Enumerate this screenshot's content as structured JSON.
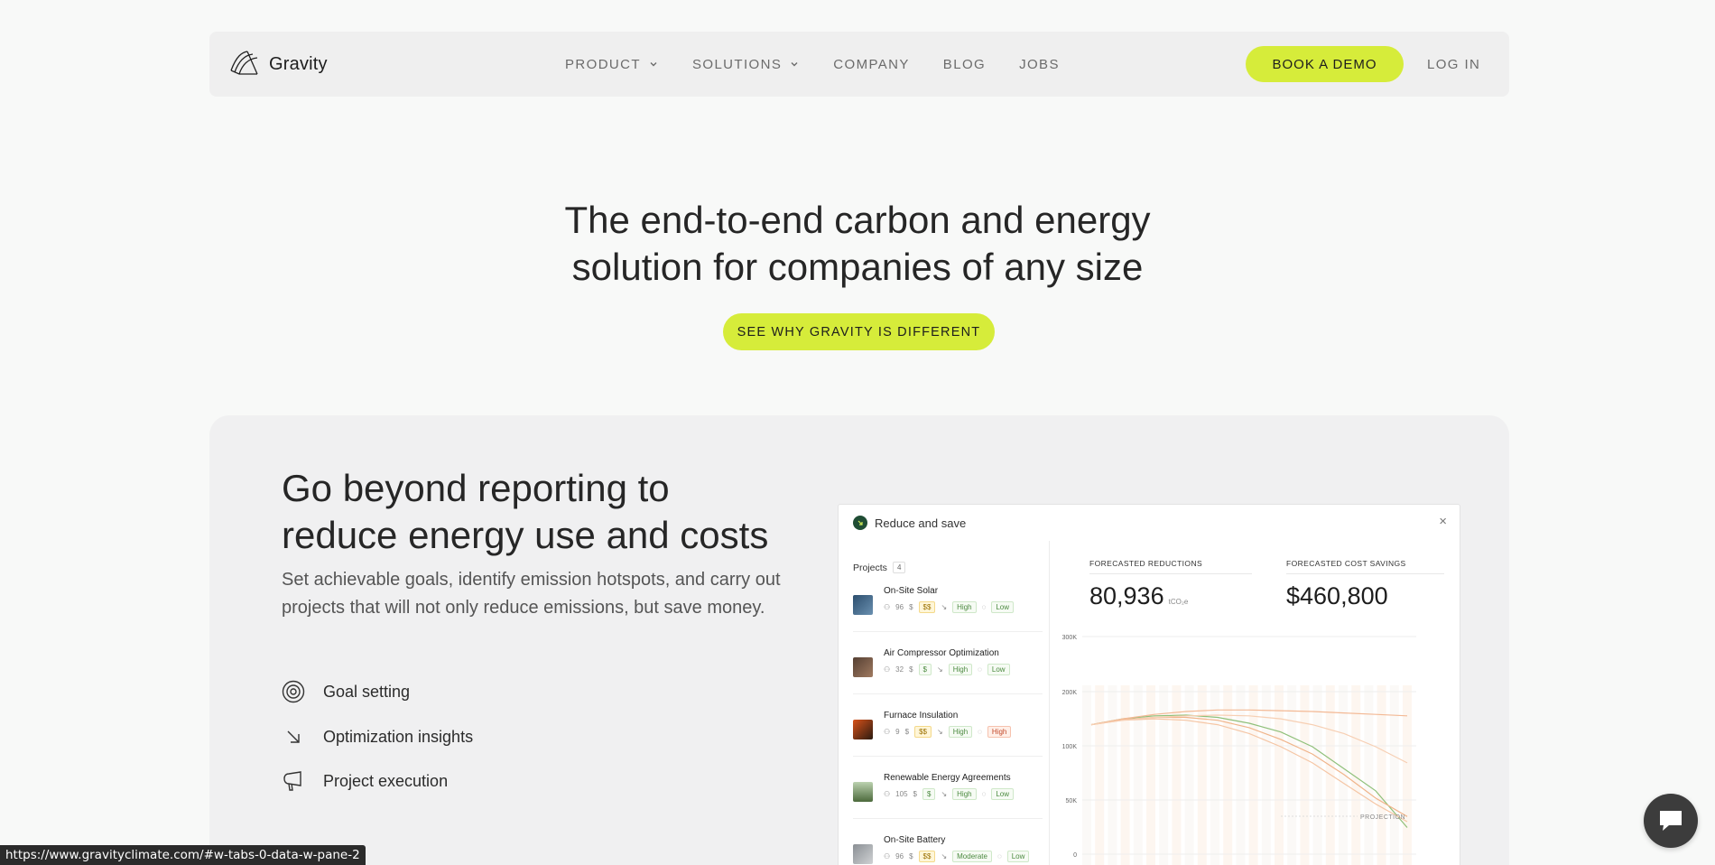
{
  "nav": {
    "logo_text": "Gravity",
    "links": [
      {
        "label": "PRODUCT",
        "dropdown": true
      },
      {
        "label": "SOLUTIONS",
        "dropdown": true
      },
      {
        "label": "COMPANY",
        "dropdown": false
      },
      {
        "label": "BLOG",
        "dropdown": false
      },
      {
        "label": "JOBS",
        "dropdown": false
      }
    ],
    "demo_label": "BOOK A DEMO",
    "login_label": "LOG IN"
  },
  "hero": {
    "title_line1": "The end-to-end carbon and energy",
    "title_line2": "solution for companies of any size",
    "cta_label": "SEE WHY GRAVITY IS DIFFERENT"
  },
  "section": {
    "title_line1": "Go beyond reporting to",
    "title_line2": "reduce energy use and costs",
    "description": "Set achievable goals, identify emission hotspots, and carry out projects that will not only reduce emissions, but save money.",
    "features": [
      {
        "label": "Goal setting",
        "icon": "target-icon"
      },
      {
        "label": "Optimization insights",
        "icon": "arrow-down-right-icon"
      },
      {
        "label": "Project execution",
        "icon": "megaphone-icon"
      }
    ]
  },
  "app": {
    "title": "Reduce and save",
    "close": "×",
    "projects_label": "Projects",
    "projects_count": "4",
    "projects": [
      {
        "name": "On-Site Solar",
        "people": "96",
        "cost": "$$",
        "impact": "High",
        "risk": "Low",
        "risk_style": "ok",
        "cost_style": "cost"
      },
      {
        "name": "Air Compressor Optimization",
        "people": "32",
        "cost": "$",
        "impact": "High",
        "risk": "Low",
        "risk_style": "ok",
        "cost_style": "ok"
      },
      {
        "name": "Furnace Insulation",
        "people": "9",
        "cost": "$$",
        "impact": "High",
        "risk": "High",
        "risk_style": "warn",
        "cost_style": "cost"
      },
      {
        "name": "Renewable Energy Agreements",
        "people": "105",
        "cost": "$",
        "impact": "High",
        "risk": "Low",
        "risk_style": "ok",
        "cost_style": "ok"
      },
      {
        "name": "On-Site Battery",
        "people": "96",
        "cost": "$$",
        "impact": "Moderate",
        "risk": "Low",
        "risk_style": "ok",
        "cost_style": "cost"
      }
    ],
    "kpi_reductions_label": "FORECASTED REDUCTIONS",
    "kpi_reductions_value": "80,936",
    "kpi_reductions_unit": "tCO₂e",
    "kpi_savings_label": "FORECASTED COST SAVINGS",
    "kpi_savings_value": "$460,800"
  },
  "chart_data": {
    "type": "line",
    "ytick_labels": [
      "300K",
      "200K",
      "100K",
      "50K",
      "0"
    ],
    "annotation": "PROJECTION",
    "series": [
      {
        "values": [
          180,
          188,
          192,
          193,
          190,
          182,
          170,
          150,
          120,
          90,
          40
        ]
      },
      {
        "values": [
          180,
          187,
          190,
          190,
          186,
          176,
          160,
          140,
          112,
          80,
          55
        ]
      },
      {
        "values": [
          180,
          186,
          188,
          186,
          180,
          168,
          150,
          128,
          100,
          72,
          48
        ]
      },
      {
        "values": [
          180,
          188,
          194,
          198,
          200,
          200,
          199,
          198,
          196,
          194,
          192
        ]
      },
      {
        "values": [
          180,
          186,
          190,
          192,
          193,
          192,
          188,
          180,
          168,
          150,
          128
        ]
      }
    ],
    "colors": [
      "#8fc07a",
      "#f0b48a",
      "#f5c6a5",
      "#f3b995",
      "#f7cfb3"
    ]
  },
  "status": {
    "url": "https://www.gravityclimate.com/#w-tabs-0-data-w-pane-2"
  },
  "colors": {
    "accent": "#d6ec3a",
    "chat_bg": "#3c3c3c"
  }
}
